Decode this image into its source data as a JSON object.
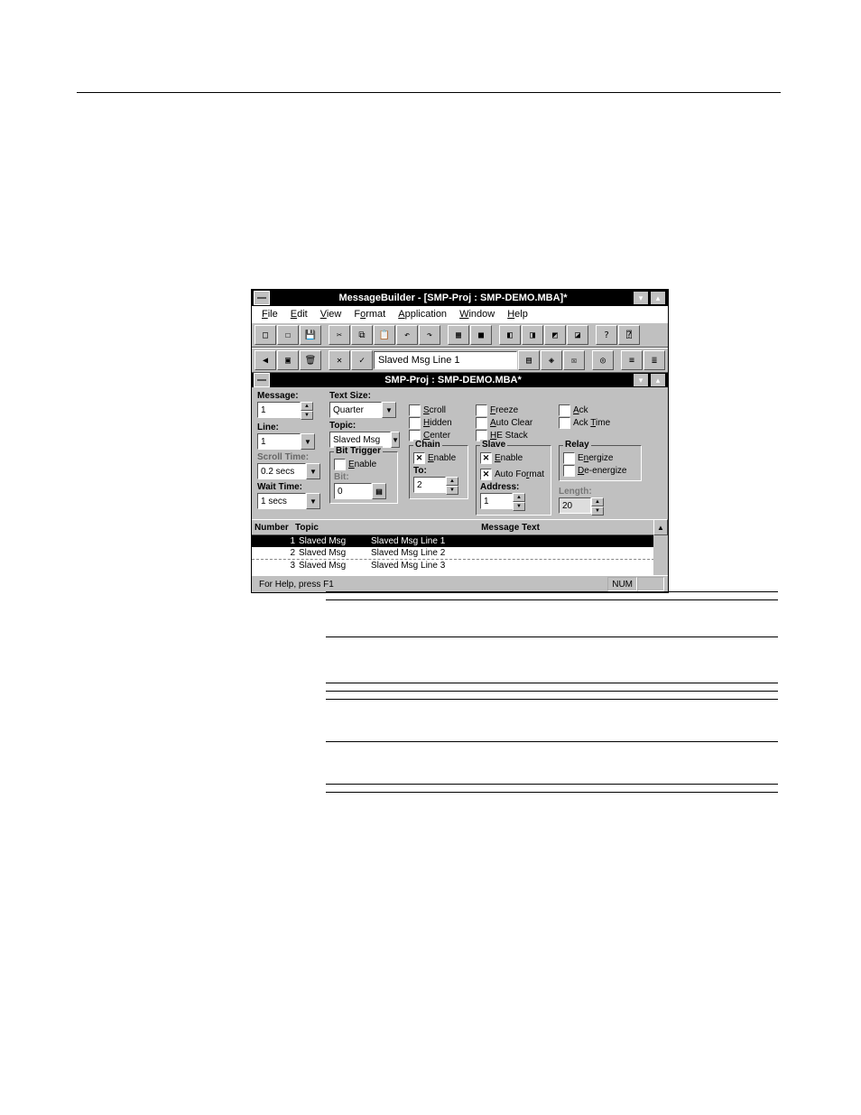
{
  "window": {
    "title": "MessageBuilder - [SMP-Proj : SMP-DEMO.MBA]*",
    "doc_title": "SMP-Proj : SMP-DEMO.MBA*"
  },
  "menus": [
    "File",
    "Edit",
    "View",
    "Format",
    "Application",
    "Window",
    "Help"
  ],
  "formatbar": {
    "text_field": "Slaved Msg Line 1"
  },
  "msgtable": {
    "message_label": "Message:",
    "message_value": "1",
    "line_label": "Line:",
    "line_value": "1",
    "scroll_time_label": "Scroll Time:",
    "scroll_time_value": "0.2 secs",
    "wait_time_label": "Wait Time:",
    "wait_time_value": "1 secs",
    "text_size_label": "Text Size:",
    "text_size_value": "Quarter",
    "topic_label": "Topic:",
    "topic_value": "Slaved Msg",
    "bit_trigger_label": "Bit Trigger",
    "bit_trigger_enable": "Enable",
    "bit_label": "Bit:",
    "bit_value": "0",
    "chain_label": "Chain",
    "chain_enable": "Enable",
    "chain_to_label": "To:",
    "chain_to_value": "2",
    "scroll": "Scroll",
    "hidden": "Hidden",
    "center": "Center",
    "freeze": "Freeze",
    "auto_clear": "Auto Clear",
    "he_stack": "HE Stack",
    "ack": "Ack",
    "ack_time": "Ack Time",
    "slave_label": "Slave",
    "slave_enable": "Enable",
    "auto_format": "Auto Format",
    "address_label": "Address:",
    "address_value": "1",
    "length_label": "Length:",
    "length_value": "20",
    "relay_label": "Relay",
    "relay_energize": "Energize",
    "relay_deenergize": "De-energize"
  },
  "list": {
    "hdr_number": "Number",
    "hdr_topic": "Topic",
    "hdr_text": "Message Text",
    "rows": [
      {
        "num": "1",
        "topic": "Slaved Msg",
        "text": "Slaved Msg Line 1"
      },
      {
        "num": "2",
        "topic": "Slaved Msg",
        "text": "Slaved Msg Line 2"
      },
      {
        "num": "3",
        "topic": "Slaved Msg",
        "text": "Slaved Msg Line 3"
      }
    ]
  },
  "status": {
    "help": "For Help, press F1",
    "num": "NUM"
  },
  "desc": {
    "rows": [
      [
        "",
        ""
      ],
      [
        "",
        ""
      ],
      [
        "",
        ""
      ],
      [
        "",
        ""
      ],
      [
        "",
        ""
      ],
      [
        "",
        ""
      ],
      [
        "",
        ""
      ],
      [
        "",
        ""
      ]
    ]
  }
}
